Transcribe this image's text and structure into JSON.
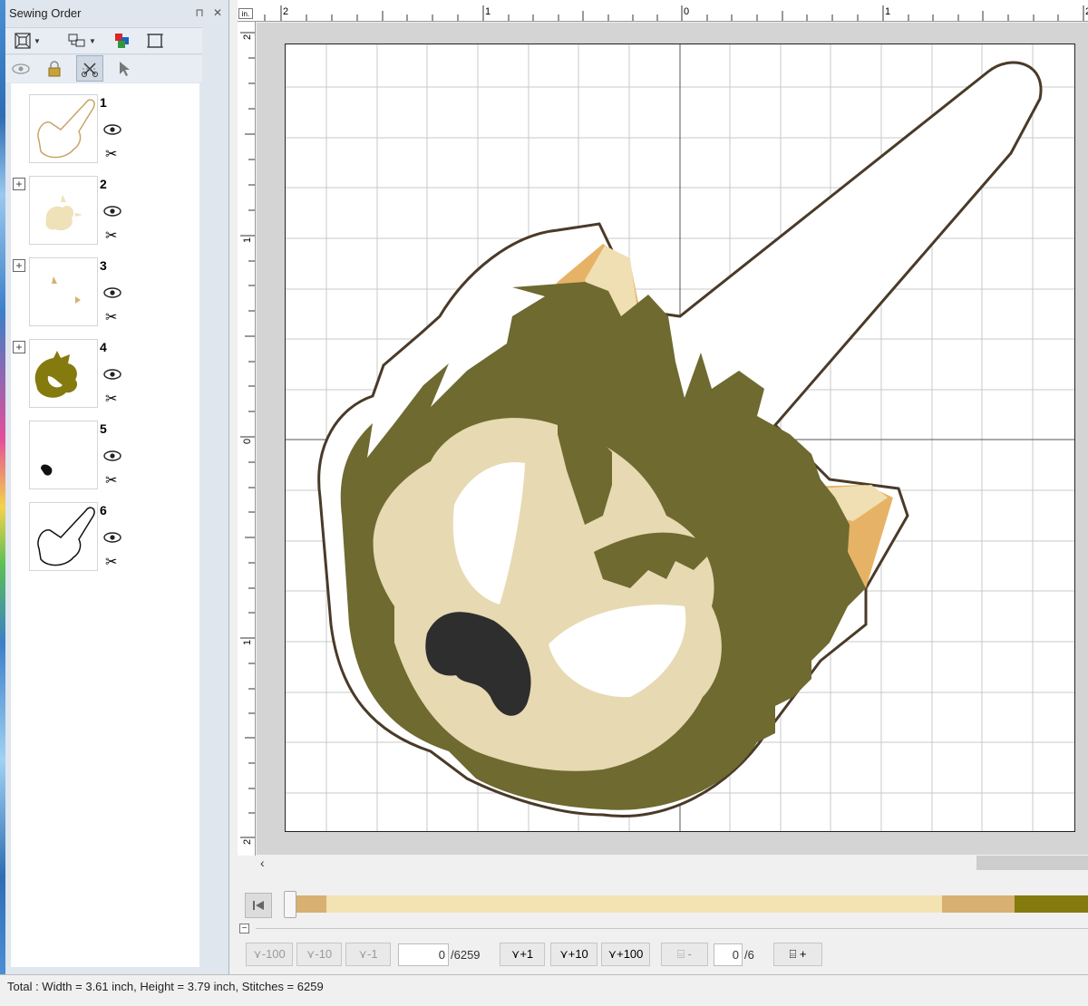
{
  "panel": {
    "title": "Sewing Order",
    "pin_glyph": "⊓",
    "close_glyph": "✕",
    "toolbar_row1": [
      {
        "icon": "fit-view-icon"
      },
      {
        "icon": "group-icon"
      },
      {
        "icon": "color-sort-icon"
      },
      {
        "icon": "hoop-frame-icon"
      }
    ],
    "toolbar_row2": [
      {
        "icon": "eye-icon"
      },
      {
        "icon": "lock-icon"
      },
      {
        "icon": "cut-jump-icon"
      },
      {
        "icon": "pointer-icon"
      }
    ],
    "items": [
      {
        "number": "1",
        "expandable": false
      },
      {
        "number": "2",
        "expandable": true
      },
      {
        "number": "3",
        "expandable": true
      },
      {
        "number": "4",
        "expandable": true
      },
      {
        "number": "5",
        "expandable": false
      },
      {
        "number": "6",
        "expandable": false
      }
    ]
  },
  "ruler": {
    "unit": "in.",
    "h_labels": [
      "2",
      "1",
      "0",
      "1",
      "2"
    ],
    "v_labels": [
      "2",
      "1",
      "0",
      "1",
      "2"
    ]
  },
  "timeline": {
    "colors": [
      "#d8b072",
      "#f3e2b2",
      "#d8b072",
      "#857a0e"
    ],
    "fractions": [
      0.04,
      0.8,
      0.095,
      0.095
    ]
  },
  "controls": {
    "back_100": "-100",
    "back_10": "-10",
    "back_1": "-1",
    "stitch_value": "0",
    "stitch_total": "/6259",
    "fwd_1": "+1",
    "fwd_10": "+10",
    "fwd_100": "+100",
    "color_prev": "-",
    "color_value": "0",
    "color_total": "/6",
    "color_next": "+"
  },
  "status": {
    "text": "Total : Width = 3.61 inch, Height = 3.79 inch, Stitches = 6259"
  },
  "colors": {
    "outline": "#4a3a28",
    "fur_dark": "#6e6a30",
    "fur_light": "#e7d9b1",
    "ear_orange": "#e6b366",
    "nose": "#2e2e2e"
  }
}
